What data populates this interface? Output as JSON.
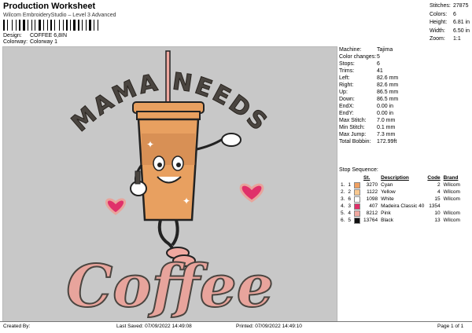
{
  "header": {
    "title": "Production Worksheet",
    "subtitle": "Wilcom EmbroideryStudio – Level 3 Advanced",
    "design_label": "Design:",
    "design_value": "COFFEE 6,8IN",
    "colorway_label": "Colorway:",
    "colorway_value": "Colorway 1"
  },
  "top_stats": [
    {
      "label": "Stitches:",
      "value": "27875"
    },
    {
      "label": "Colors:",
      "value": "6"
    },
    {
      "label": "Height:",
      "value": "6.81 in"
    },
    {
      "label": "Width:",
      "value": "6.50 in"
    },
    {
      "label": "Zoom:",
      "value": "1:1"
    }
  ],
  "artwork": {
    "arch_text": "MAMA NEEDS",
    "script_text": "Coffee"
  },
  "specs": [
    {
      "label": "Machine:",
      "value": "Tajima"
    },
    {
      "label": "Color changes:",
      "value": "5"
    },
    {
      "label": "Stops:",
      "value": "6"
    },
    {
      "label": "Trims:",
      "value": "41"
    },
    {
      "label": "Left:",
      "value": "82.6 mm"
    },
    {
      "label": "Right:",
      "value": "82.6 mm"
    },
    {
      "label": "Up:",
      "value": "86.5 mm"
    },
    {
      "label": "Down:",
      "value": "86.5 mm"
    },
    {
      "label": "EndX:",
      "value": "0.00 in"
    },
    {
      "label": "EndY:",
      "value": "0.00 in"
    },
    {
      "label": "Max Stitch:",
      "value": "7.0 mm"
    },
    {
      "label": "Min Stitch:",
      "value": "0.1 mm"
    },
    {
      "label": "Max Jump:",
      "value": "7.3 mm"
    },
    {
      "label": "Total Bobbin:",
      "value": "172.99ft"
    }
  ],
  "stop_sequence": {
    "title": "Stop Sequence:",
    "headers": {
      "st": "St.",
      "description": "Description",
      "code": "Code",
      "brand": "Brand"
    },
    "rows": [
      {
        "stop": "1.",
        "color_no": "1",
        "st": "3270",
        "description": "Cyan",
        "code": "2",
        "brand": "Wilcom",
        "swatch": "#f0a060"
      },
      {
        "stop": "2.",
        "color_no": "2",
        "st": "1122",
        "description": "Yellow",
        "code": "4",
        "brand": "Wilcom",
        "swatch": "#f8c890"
      },
      {
        "stop": "3.",
        "color_no": "6",
        "st": "1098",
        "description": "White",
        "code": "15",
        "brand": "Wilcom",
        "swatch": "#ffffff"
      },
      {
        "stop": "4.",
        "color_no": "3",
        "st": "407",
        "description": "Madeira Classic 40",
        "code": "1354",
        "brand": "",
        "swatch": "#e0306a"
      },
      {
        "stop": "5.",
        "color_no": "4",
        "st": "8212",
        "description": "Pink",
        "code": "10",
        "brand": "Wilcom",
        "swatch": "#f0a8a0"
      },
      {
        "stop": "6.",
        "color_no": "5",
        "st": "13764",
        "description": "Black",
        "code": "13",
        "brand": "Wilcom",
        "swatch": "#111111"
      }
    ]
  },
  "footer": {
    "created_by": "Created By:",
    "last_saved": "Last Saved: 07/09/2022 14:49:08",
    "printed": "Printed: 07/09/2022 14:49:10",
    "page": "Page 1 of 1"
  },
  "colors": {
    "background": "#c8c8c8",
    "cup": "#e8a060",
    "cup_dark": "#c8804a",
    "text_dark": "#4a4540",
    "pink": "#e8a49c"
  }
}
